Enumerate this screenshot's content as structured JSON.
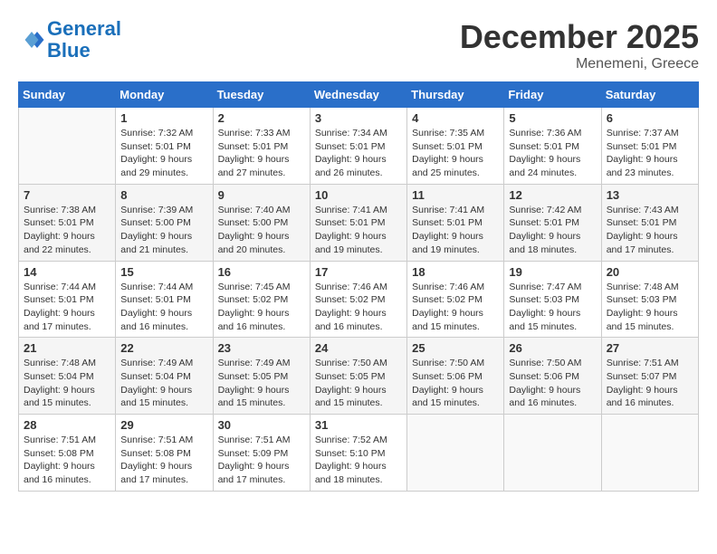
{
  "header": {
    "logo_line1": "General",
    "logo_line2": "Blue",
    "month": "December 2025",
    "location": "Menemeni, Greece"
  },
  "days_of_week": [
    "Sunday",
    "Monday",
    "Tuesday",
    "Wednesday",
    "Thursday",
    "Friday",
    "Saturday"
  ],
  "weeks": [
    [
      {
        "day": "",
        "info": ""
      },
      {
        "day": "1",
        "info": "Sunrise: 7:32 AM\nSunset: 5:01 PM\nDaylight: 9 hours\nand 29 minutes."
      },
      {
        "day": "2",
        "info": "Sunrise: 7:33 AM\nSunset: 5:01 PM\nDaylight: 9 hours\nand 27 minutes."
      },
      {
        "day": "3",
        "info": "Sunrise: 7:34 AM\nSunset: 5:01 PM\nDaylight: 9 hours\nand 26 minutes."
      },
      {
        "day": "4",
        "info": "Sunrise: 7:35 AM\nSunset: 5:01 PM\nDaylight: 9 hours\nand 25 minutes."
      },
      {
        "day": "5",
        "info": "Sunrise: 7:36 AM\nSunset: 5:01 PM\nDaylight: 9 hours\nand 24 minutes."
      },
      {
        "day": "6",
        "info": "Sunrise: 7:37 AM\nSunset: 5:01 PM\nDaylight: 9 hours\nand 23 minutes."
      }
    ],
    [
      {
        "day": "7",
        "info": "Sunrise: 7:38 AM\nSunset: 5:01 PM\nDaylight: 9 hours\nand 22 minutes."
      },
      {
        "day": "8",
        "info": "Sunrise: 7:39 AM\nSunset: 5:00 PM\nDaylight: 9 hours\nand 21 minutes."
      },
      {
        "day": "9",
        "info": "Sunrise: 7:40 AM\nSunset: 5:00 PM\nDaylight: 9 hours\nand 20 minutes."
      },
      {
        "day": "10",
        "info": "Sunrise: 7:41 AM\nSunset: 5:01 PM\nDaylight: 9 hours\nand 19 minutes."
      },
      {
        "day": "11",
        "info": "Sunrise: 7:41 AM\nSunset: 5:01 PM\nDaylight: 9 hours\nand 19 minutes."
      },
      {
        "day": "12",
        "info": "Sunrise: 7:42 AM\nSunset: 5:01 PM\nDaylight: 9 hours\nand 18 minutes."
      },
      {
        "day": "13",
        "info": "Sunrise: 7:43 AM\nSunset: 5:01 PM\nDaylight: 9 hours\nand 17 minutes."
      }
    ],
    [
      {
        "day": "14",
        "info": "Sunrise: 7:44 AM\nSunset: 5:01 PM\nDaylight: 9 hours\nand 17 minutes."
      },
      {
        "day": "15",
        "info": "Sunrise: 7:44 AM\nSunset: 5:01 PM\nDaylight: 9 hours\nand 16 minutes."
      },
      {
        "day": "16",
        "info": "Sunrise: 7:45 AM\nSunset: 5:02 PM\nDaylight: 9 hours\nand 16 minutes."
      },
      {
        "day": "17",
        "info": "Sunrise: 7:46 AM\nSunset: 5:02 PM\nDaylight: 9 hours\nand 16 minutes."
      },
      {
        "day": "18",
        "info": "Sunrise: 7:46 AM\nSunset: 5:02 PM\nDaylight: 9 hours\nand 15 minutes."
      },
      {
        "day": "19",
        "info": "Sunrise: 7:47 AM\nSunset: 5:03 PM\nDaylight: 9 hours\nand 15 minutes."
      },
      {
        "day": "20",
        "info": "Sunrise: 7:48 AM\nSunset: 5:03 PM\nDaylight: 9 hours\nand 15 minutes."
      }
    ],
    [
      {
        "day": "21",
        "info": "Sunrise: 7:48 AM\nSunset: 5:04 PM\nDaylight: 9 hours\nand 15 minutes."
      },
      {
        "day": "22",
        "info": "Sunrise: 7:49 AM\nSunset: 5:04 PM\nDaylight: 9 hours\nand 15 minutes."
      },
      {
        "day": "23",
        "info": "Sunrise: 7:49 AM\nSunset: 5:05 PM\nDaylight: 9 hours\nand 15 minutes."
      },
      {
        "day": "24",
        "info": "Sunrise: 7:50 AM\nSunset: 5:05 PM\nDaylight: 9 hours\nand 15 minutes."
      },
      {
        "day": "25",
        "info": "Sunrise: 7:50 AM\nSunset: 5:06 PM\nDaylight: 9 hours\nand 15 minutes."
      },
      {
        "day": "26",
        "info": "Sunrise: 7:50 AM\nSunset: 5:06 PM\nDaylight: 9 hours\nand 16 minutes."
      },
      {
        "day": "27",
        "info": "Sunrise: 7:51 AM\nSunset: 5:07 PM\nDaylight: 9 hours\nand 16 minutes."
      }
    ],
    [
      {
        "day": "28",
        "info": "Sunrise: 7:51 AM\nSunset: 5:08 PM\nDaylight: 9 hours\nand 16 minutes."
      },
      {
        "day": "29",
        "info": "Sunrise: 7:51 AM\nSunset: 5:08 PM\nDaylight: 9 hours\nand 17 minutes."
      },
      {
        "day": "30",
        "info": "Sunrise: 7:51 AM\nSunset: 5:09 PM\nDaylight: 9 hours\nand 17 minutes."
      },
      {
        "day": "31",
        "info": "Sunrise: 7:52 AM\nSunset: 5:10 PM\nDaylight: 9 hours\nand 18 minutes."
      },
      {
        "day": "",
        "info": ""
      },
      {
        "day": "",
        "info": ""
      },
      {
        "day": "",
        "info": ""
      }
    ]
  ]
}
